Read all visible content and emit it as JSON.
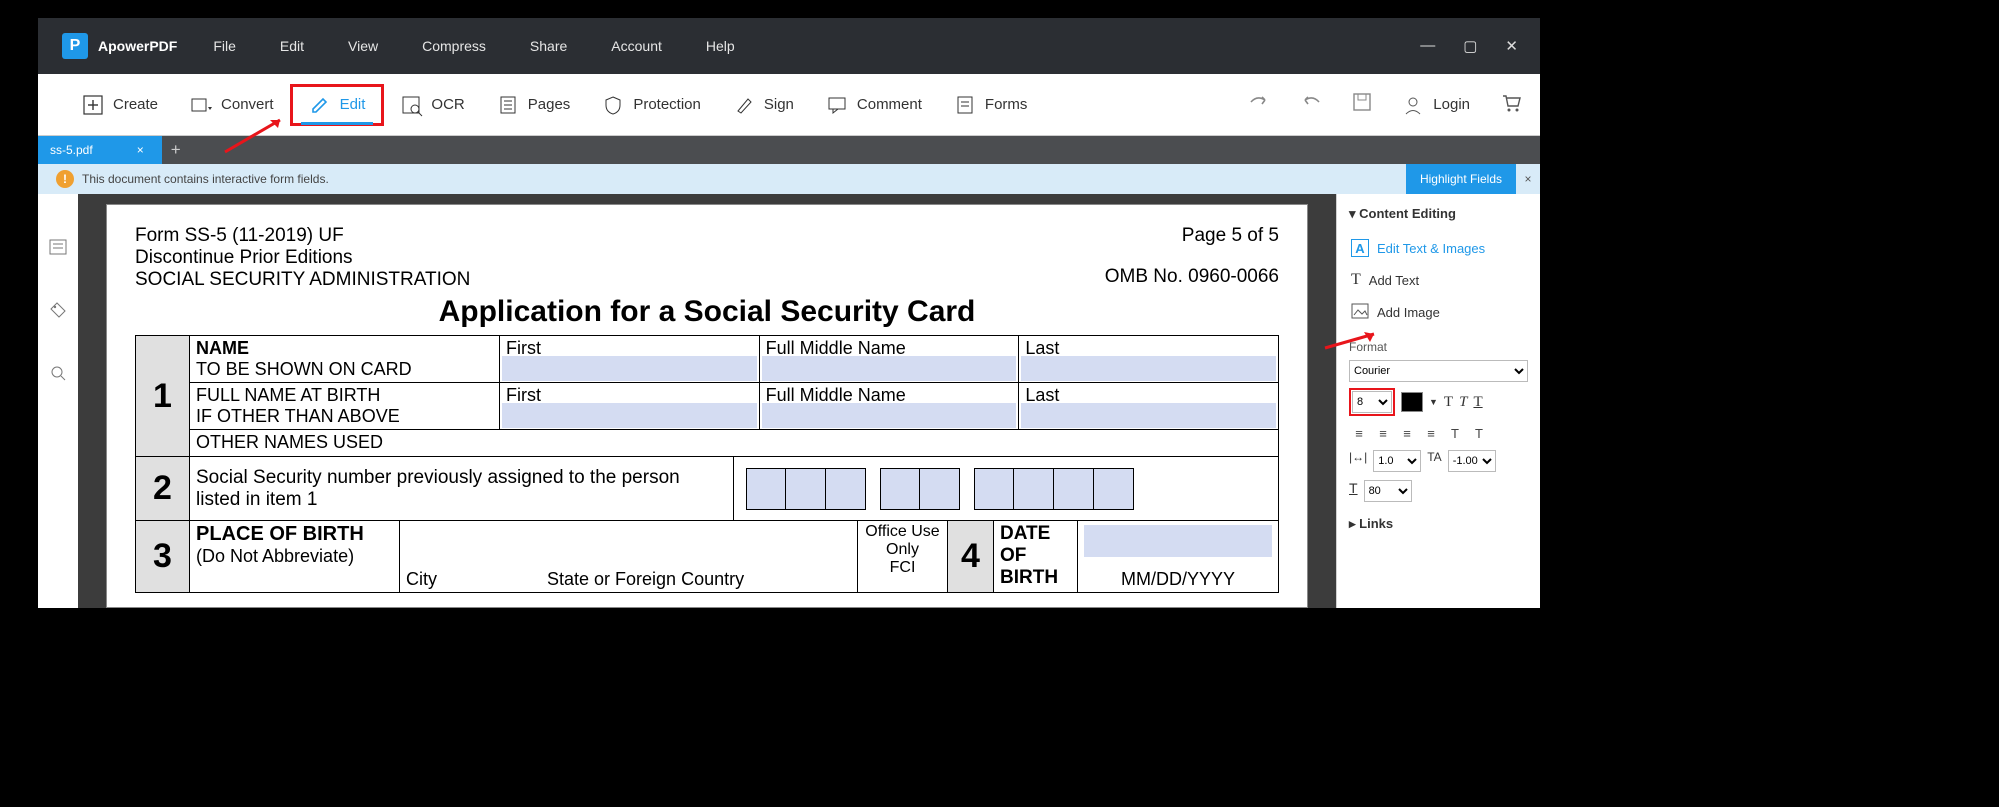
{
  "app": {
    "name": "ApowerPDF"
  },
  "menu": {
    "file": "File",
    "edit": "Edit",
    "view": "View",
    "compress": "Compress",
    "share": "Share",
    "account": "Account",
    "help": "Help"
  },
  "tools": {
    "create": "Create",
    "convert": "Convert",
    "edit": "Edit",
    "ocr": "OCR",
    "pages": "Pages",
    "protection": "Protection",
    "sign": "Sign",
    "comment": "Comment",
    "forms": "Forms",
    "login": "Login"
  },
  "tab": {
    "name": "ss-5.pdf"
  },
  "banner": {
    "msg": "This document contains interactive form fields.",
    "btn": "Highlight Fields"
  },
  "side": {
    "content_editing": "Content Editing",
    "edit_text": "Edit Text & Images",
    "add_text": "Add Text",
    "add_image": "Add Image",
    "format": "Format",
    "font": "Courier",
    "size": "8",
    "lh": "1.0",
    "ls": "-1.00",
    "sc": "80",
    "links": "Links"
  },
  "doc": {
    "form_no": "Form SS-5 (11-2019) UF",
    "discontinue": "Discontinue Prior Editions",
    "admin": "SOCIAL SECURITY ADMINISTRATION",
    "page": "Page 5 of 5",
    "omb": "OMB No. 0960-0066",
    "title": "Application for a Social Security Card",
    "name": "NAME",
    "shown": "TO BE SHOWN ON CARD",
    "first": "First",
    "middle": "Full Middle Name",
    "last": "Last",
    "birth": "FULL NAME AT BIRTH",
    "other_than": "IF OTHER THAN ABOVE",
    "other_names": "OTHER NAMES USED",
    "ssn": "Social Security number previously assigned to the person listed in item 1",
    "place": "PLACE OF BIRTH",
    "abbrev": "(Do Not Abbreviate)",
    "city": "City",
    "state": "State or Foreign Country",
    "office": "Office Use Only",
    "fci": "FCI",
    "dob": "DATE OF BIRTH",
    "mdy": "MM/DD/YYYY"
  }
}
